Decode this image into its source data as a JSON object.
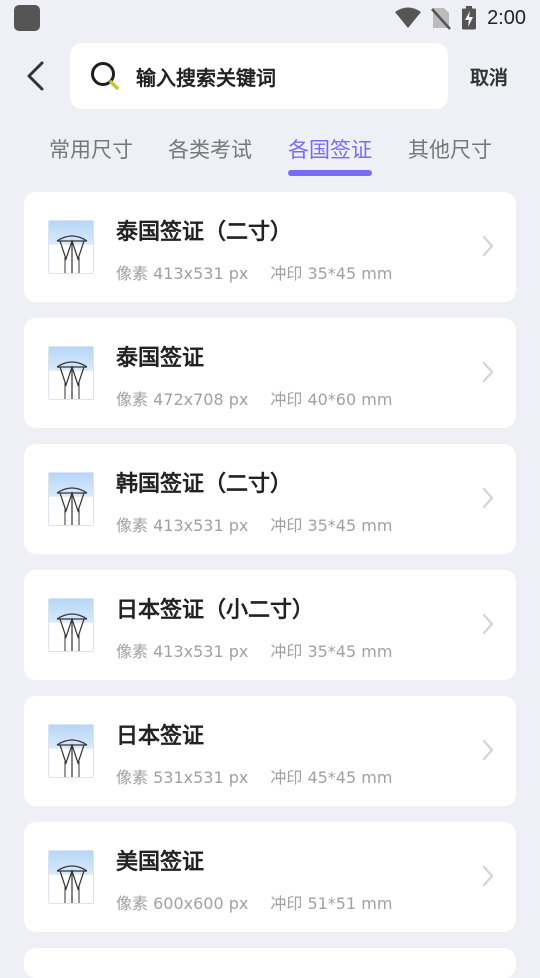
{
  "status_bar": {
    "time": "2:00"
  },
  "search": {
    "placeholder": "输入搜索关键词",
    "cancel_label": "取消"
  },
  "tabs": [
    {
      "label": "常用尺寸",
      "active": false
    },
    {
      "label": "各类考试",
      "active": false
    },
    {
      "label": "各国签证",
      "active": true
    },
    {
      "label": "其他尺寸",
      "active": false
    }
  ],
  "colors": {
    "accent": "#7a6cf2",
    "background": "#eef0f6",
    "card": "#ffffff",
    "meta_text": "#a0a0a6"
  },
  "items": [
    {
      "title": "泰国签证（二寸）",
      "pixels": "像素 413x531 px",
      "print": "冲印 35*45 mm"
    },
    {
      "title": "泰国签证",
      "pixels": "像素 472x708 px",
      "print": "冲印 40*60 mm"
    },
    {
      "title": "韩国签证（二寸）",
      "pixels": "像素 413x531 px",
      "print": "冲印 35*45 mm"
    },
    {
      "title": "日本签证（小二寸）",
      "pixels": "像素 413x531 px",
      "print": "冲印 35*45 mm"
    },
    {
      "title": "日本签证",
      "pixels": "像素 531x531 px",
      "print": "冲印 45*45 mm"
    },
    {
      "title": "美国签证",
      "pixels": "像素 600x600 px",
      "print": "冲印 51*51 mm"
    }
  ],
  "icons": {
    "back": "back-arrow-icon",
    "search": "search-icon",
    "thumbnail": "photo-thumbnail-icon",
    "chevron": "chevron-right-icon"
  }
}
